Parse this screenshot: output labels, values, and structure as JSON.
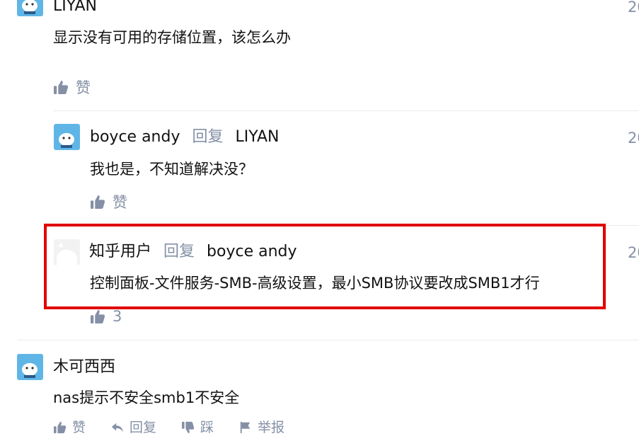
{
  "comments": [
    {
      "author": "LIYAN",
      "date": "20",
      "content": "显示没有可用的存储位置，该怎么办",
      "like_label": "赞"
    },
    {
      "author": "boyce andy",
      "reply_word": "回复",
      "reply_to": "LIYAN",
      "date": "20",
      "content": "我也是，不知道解决没？",
      "like_label": "赞"
    },
    {
      "author": "知乎用户",
      "reply_word": "回复",
      "reply_to": "boyce andy",
      "date": "20",
      "content": "控制面板-文件服务-SMB-高级设置，最小SMB协议要改成SMB1才行",
      "like_label": "3"
    },
    {
      "author": "木可西西",
      "content": "nas提示不安全smb1不安全"
    }
  ],
  "bottom_actions": {
    "like": "赞",
    "reply": "回复",
    "dislike": "踩",
    "report": "举报"
  },
  "colors": {
    "highlight": "#e10000",
    "meta": "#8590a6",
    "avatar_bg": "#5fb6e6"
  }
}
